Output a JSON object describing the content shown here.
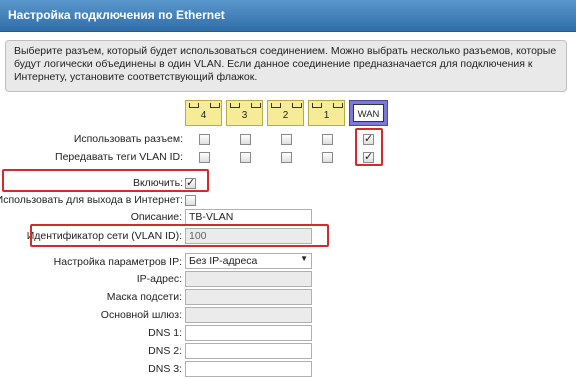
{
  "header": {
    "title": "Настройка подключения по Ethernet"
  },
  "info_text": "Выберите разъем, который будет использоваться соединением. Можно выбрать несколько разъемов, которые будут логически объединены в один VLAN. Если данное соединение предназначается для подключения к Интернету, установите соответствующий флажок.",
  "ports": [
    "4",
    "3",
    "2",
    "1",
    "WAN"
  ],
  "rows": {
    "use_port": {
      "label": "Использовать разъем:",
      "checked": [
        false,
        false,
        false,
        false,
        true
      ]
    },
    "vlan_tags": {
      "label": "Передавать теги VLAN ID:",
      "checked": [
        false,
        false,
        false,
        false,
        true
      ]
    }
  },
  "enable": {
    "label": "Включить:",
    "checked": true
  },
  "internet": {
    "label": "Использовать для выхода в Интернет:",
    "checked": false
  },
  "description": {
    "label": "Описание:",
    "value": "TB-VLAN"
  },
  "vlan_id": {
    "label": "Идентификатор сети (VLAN ID):",
    "value": "100"
  },
  "ip_settings": {
    "label": "Настройка параметров IP:",
    "value": "Без IP-адреса"
  },
  "ip_address": {
    "label": "IP-адрес:",
    "value": ""
  },
  "subnet_mask": {
    "label": "Маска подсети:",
    "value": ""
  },
  "gateway": {
    "label": "Основной шлюз:",
    "value": ""
  },
  "dns1": {
    "label": "DNS 1:",
    "value": ""
  },
  "dns2": {
    "label": "DNS 2:",
    "value": ""
  },
  "dns3": {
    "label": "DNS 3:",
    "value": ""
  },
  "colors": {
    "title_bar": "#3d7fbf",
    "port": "#f6ec98",
    "wan_port": "#7a78d8",
    "highlight": "#d42a2a"
  }
}
